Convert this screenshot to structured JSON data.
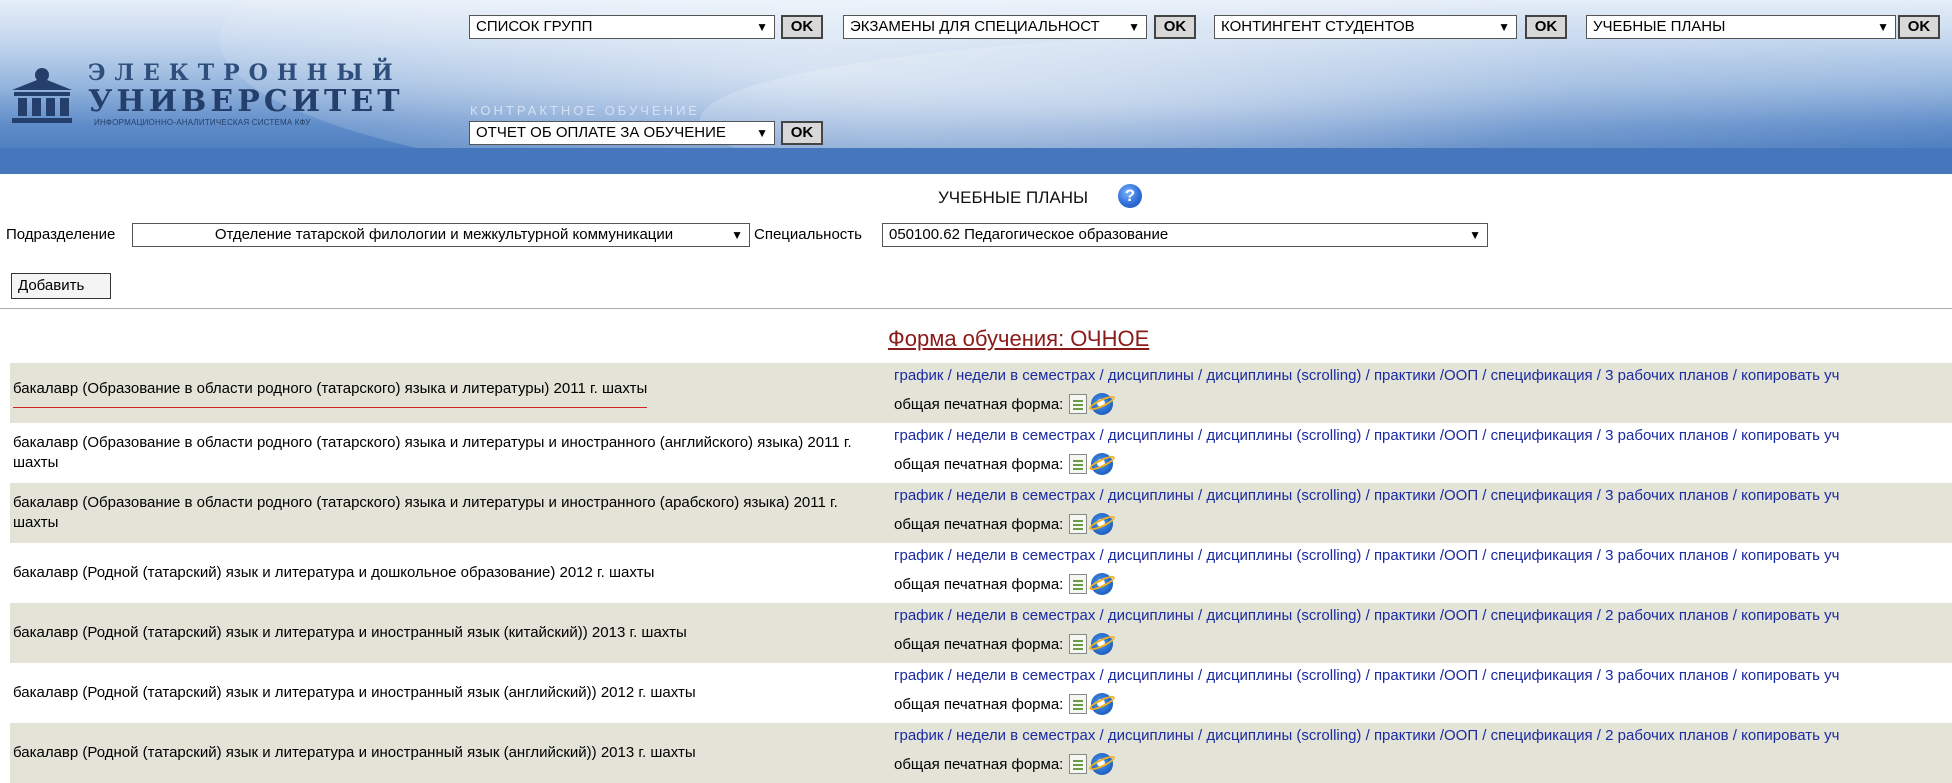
{
  "header": {
    "logo": {
      "line1": "ЭЛЕКТРОННЫЙ",
      "line2": "УНИВЕРСИТЕТ",
      "line3": "ИНФОРМАЦИОННО-АНАЛИТИЧЕСКАЯ СИСТЕМА КФУ"
    },
    "ok_label": "OK",
    "top_selects": [
      {
        "value": "СПИСОК ГРУПП"
      },
      {
        "value": "ЭКЗАМЕНЫ ДЛЯ СПЕЦИАЛЬНОСТ"
      },
      {
        "value": "КОНТИНГЕНТ СТУДЕНТОВ"
      },
      {
        "value": "УЧЕБНЫЕ ПЛАНЫ"
      }
    ],
    "contract_label": "КОНТРАКТНОЕ ОБУЧЕНИЕ",
    "contract_select": "ОТЧЕТ ОБ ОПЛАТЕ ЗА ОБУЧЕНИЕ"
  },
  "page": {
    "title": "УЧЕБНЫЕ ПЛАНЫ",
    "help_glyph": "?",
    "division_label": "Подразделение",
    "division_value": "Отделение татарской филологии и межкультурной коммуникации",
    "specialty_label": "Специальность",
    "specialty_value": "050100.62 Педагогическое образование",
    "add_button": "Добавить",
    "section_title": "Форма обучения: ОЧНОЕ",
    "print_form_label": "общая печатная форма:"
  },
  "link_labels": {
    "schedule": "график",
    "weeks": "недели в семестрах",
    "disciplines": "дисциплины",
    "disciplines_scrolling": "дисциплины (scrolling)",
    "practices": "практики",
    "oop": "ООП",
    "specification": "спецификация",
    "copy": "копировать уч"
  },
  "rows": [
    {
      "name": "бакалавр (Образование в области родного (татарского) языка и литературы) 2011 г. шахты",
      "work_plans": "3 рабочих планов"
    },
    {
      "name": "бакалавр (Образование в области родного (татарского) языка и литературы и иностранного (английского) языка) 2011 г. шахты",
      "work_plans": "3 рабочих планов"
    },
    {
      "name": "бакалавр (Образование в области родного (татарского) языка и литературы и иностранного (арабского) языка) 2011 г. шахты",
      "work_plans": "3 рабочих планов"
    },
    {
      "name": "бакалавр (Родной (татарский) язык и литература и дошкольное образование) 2012 г. шахты",
      "work_plans": "3 рабочих планов"
    },
    {
      "name": "бакалавр (Родной (татарский) язык и литература и иностранный язык (китайский)) 2013 г. шахты",
      "work_plans": "2 рабочих планов"
    },
    {
      "name": "бакалавр (Родной (татарский) язык и литература и иностранный язык (английский)) 2012 г. шахты",
      "work_plans": "3 рабочих планов"
    },
    {
      "name": "бакалавр (Родной (татарский) язык и литература и иностранный язык (английский)) 2013 г. шахты",
      "work_plans": "2 рабочих планов"
    }
  ]
}
